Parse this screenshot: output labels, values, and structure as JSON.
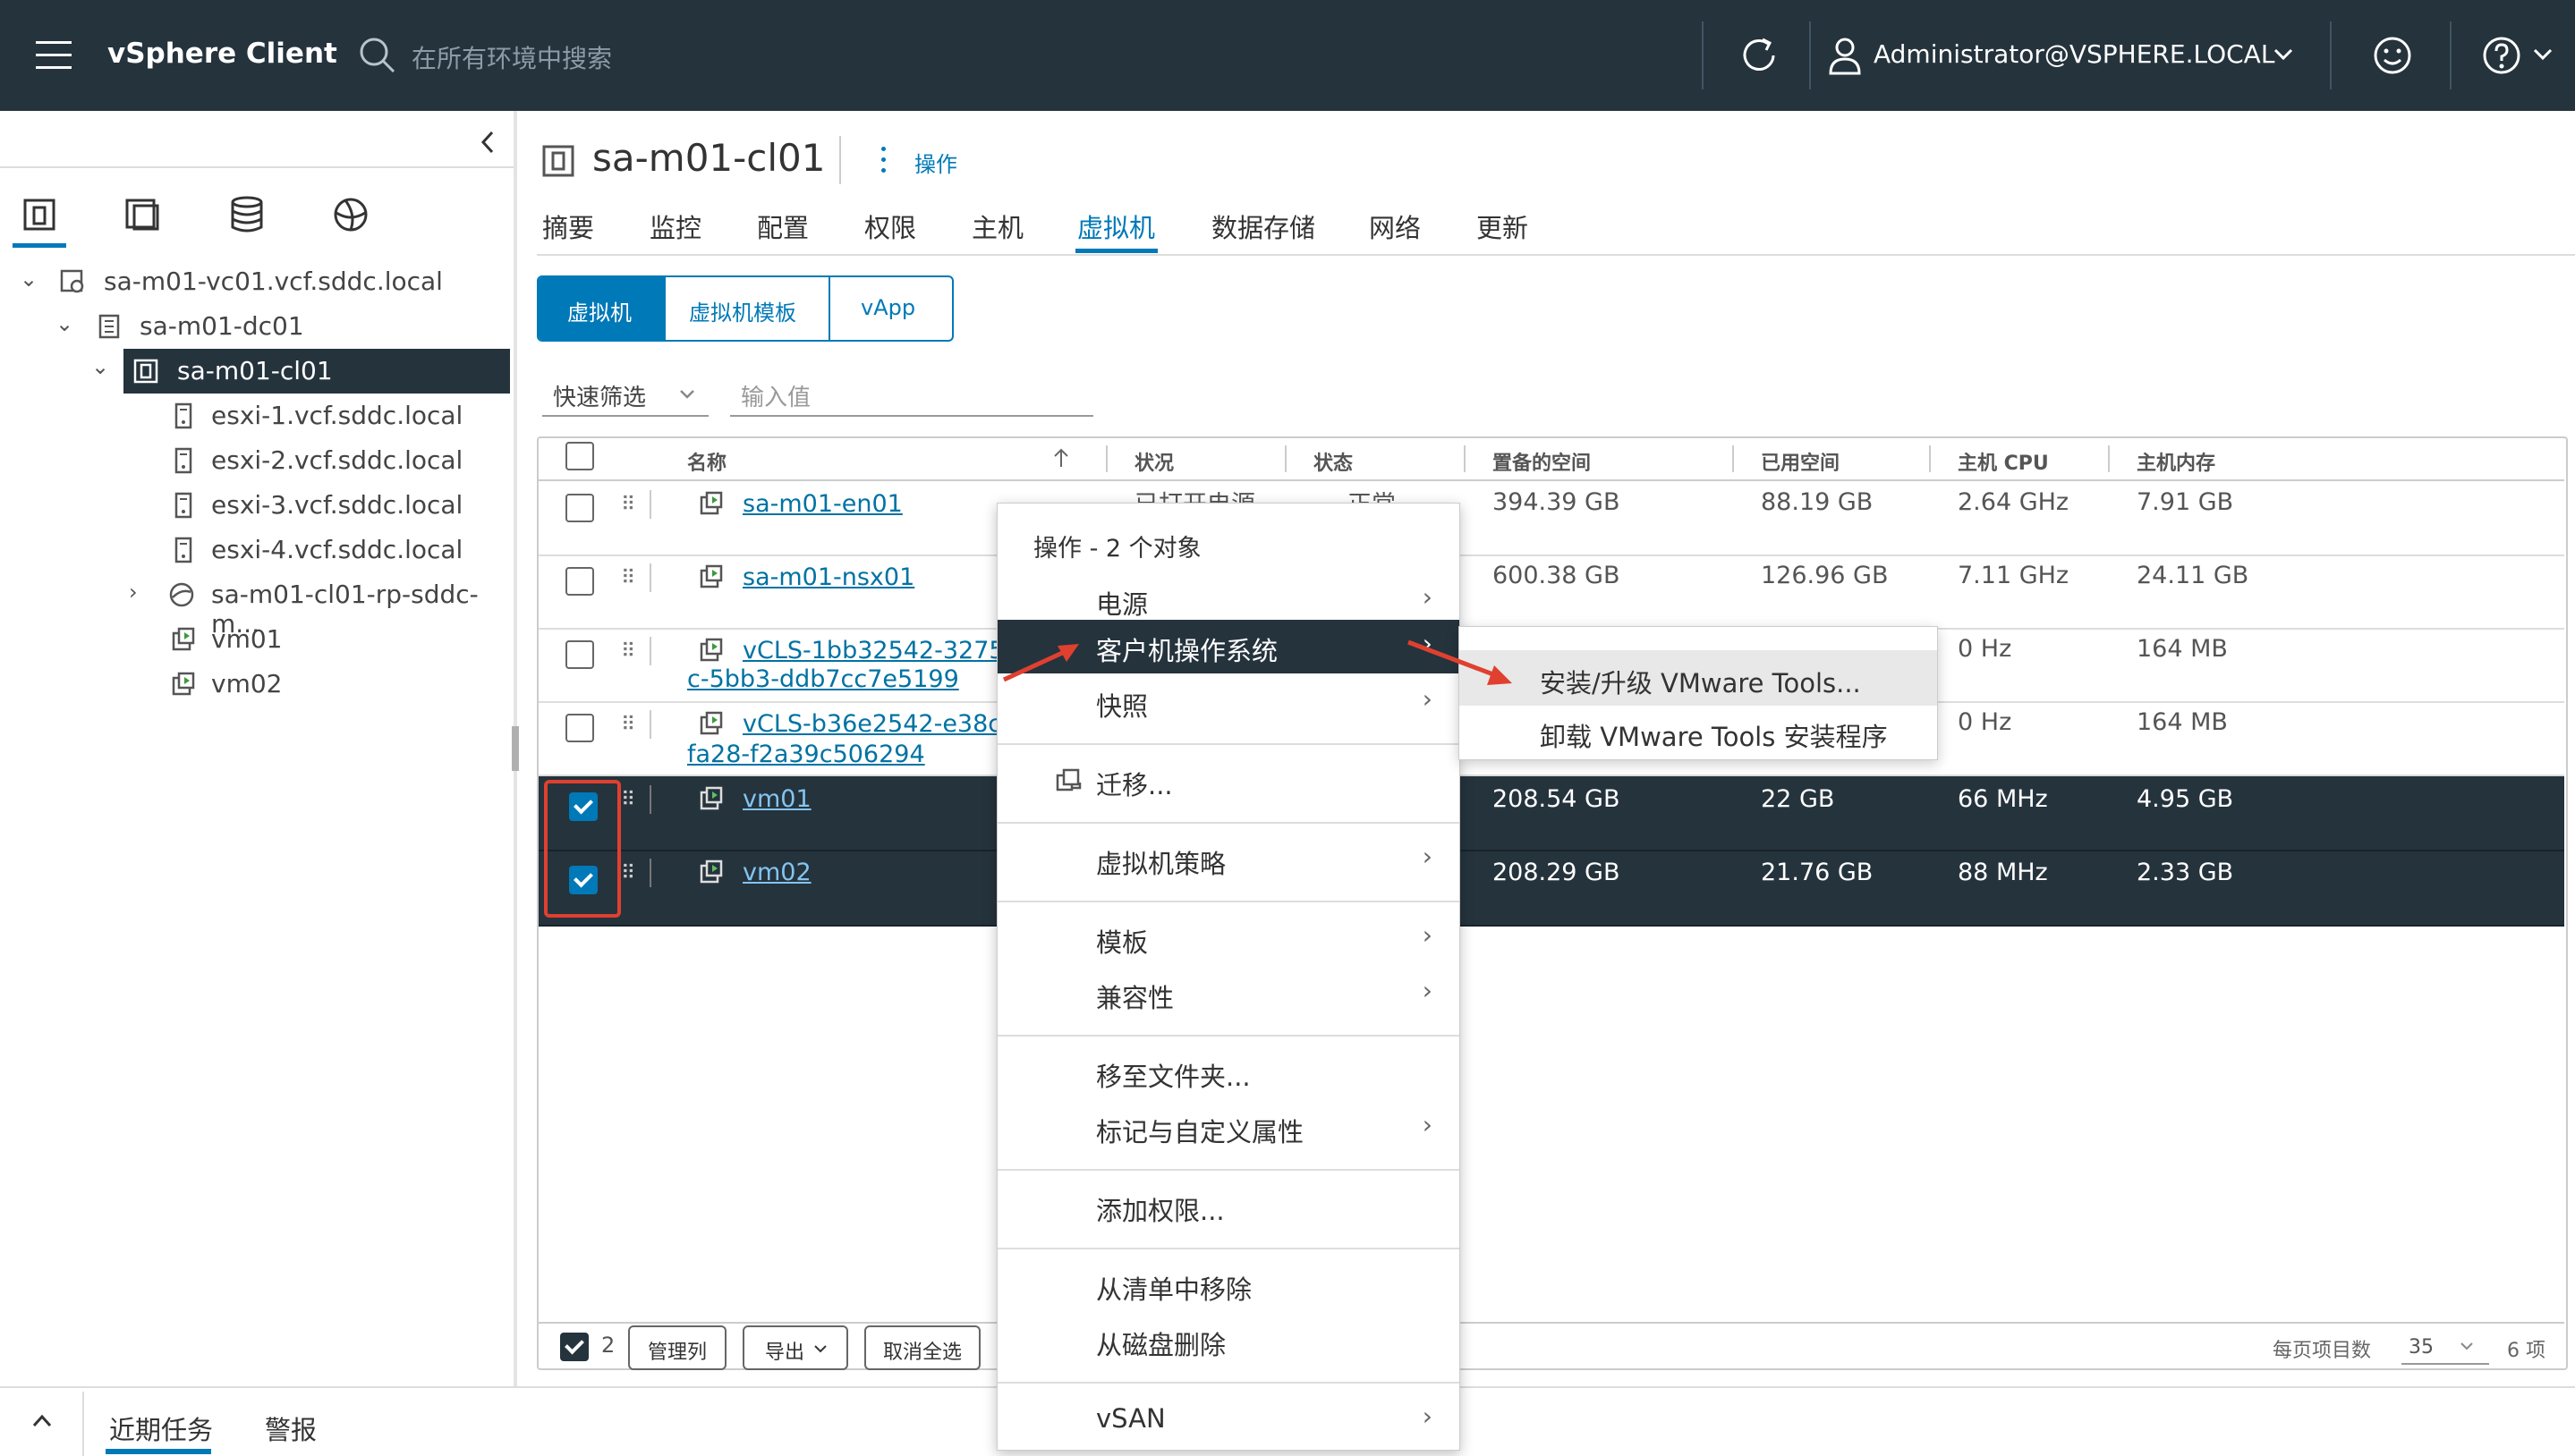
{
  "header": {
    "app_title": "vSphere Client",
    "search_placeholder": "在所有环境中搜索",
    "user": "Administrator@VSPHERE.LOCAL"
  },
  "sidebar": {
    "tree": [
      {
        "label": "sa-m01-vc01.vcf.sddc.local"
      },
      {
        "label": "sa-m01-dc01"
      },
      {
        "label": "sa-m01-cl01"
      },
      {
        "label": "esxi-1.vcf.sddc.local"
      },
      {
        "label": "esxi-2.vcf.sddc.local"
      },
      {
        "label": "esxi-3.vcf.sddc.local"
      },
      {
        "label": "esxi-4.vcf.sddc.local"
      },
      {
        "label": "sa-m01-cl01-rp-sddc-m..."
      },
      {
        "label": "vm01"
      },
      {
        "label": "vm02"
      }
    ]
  },
  "object": {
    "title": "sa-m01-cl01",
    "actions_label": "操作"
  },
  "tabs": [
    "摘要",
    "监控",
    "配置",
    "权限",
    "主机",
    "虚拟机",
    "数据存储",
    "网络",
    "更新"
  ],
  "subtabs": [
    "虚拟机",
    "虚拟机模板",
    "vApp"
  ],
  "filter": {
    "quick_filter": "快速筛选",
    "input_placeholder": "输入值"
  },
  "grid": {
    "columns": [
      "名称",
      "状况",
      "状态",
      "置备的空间",
      "已用空间",
      "主机 CPU",
      "主机内存"
    ],
    "rows": [
      {
        "name": "sa-m01-en01",
        "name2": "",
        "status": "已打开电源",
        "state": "正常",
        "prov": "394.39 GB",
        "used": "88.19 GB",
        "cpu": "2.64 GHz",
        "mem": "7.91 GB"
      },
      {
        "name": "sa-m01-nsx01",
        "name2": "",
        "status": "",
        "state": "",
        "prov": "600.38 GB",
        "used": "126.96 GB",
        "cpu": "7.11 GHz",
        "mem": "24.11 GB"
      },
      {
        "name": "vCLS-1bb32542-3275-",
        "name2": "c-5bb3-ddb7cc7e5199",
        "status": "",
        "state": "",
        "prov": "",
        "used": "",
        "cpu": "0 Hz",
        "mem": "164 MB"
      },
      {
        "name": "vCLS-b36e2542-e38c",
        "name2": "fa28-f2a39c506294",
        "status": "",
        "state": "",
        "prov": "",
        "used": "",
        "cpu": "0 Hz",
        "mem": "164 MB"
      },
      {
        "name": "vm01",
        "name2": "",
        "status": "",
        "state": "",
        "prov": "208.54 GB",
        "used": "22 GB",
        "cpu": "66 MHz",
        "mem": "4.95 GB"
      },
      {
        "name": "vm02",
        "name2": "",
        "status": "",
        "state": "",
        "prov": "208.29 GB",
        "used": "21.76 GB",
        "cpu": "88 MHz",
        "mem": "2.33 GB"
      }
    ]
  },
  "footer": {
    "selected_count": "2",
    "manage_columns": "管理列",
    "export": "导出",
    "deselect_all": "取消全选",
    "per_page_label": "每页项目数",
    "per_page": "35",
    "total": "6 项"
  },
  "bottom_tabs": [
    "近期任务",
    "警报"
  ],
  "context_menu": {
    "title": "操作 - 2 个对象",
    "items": [
      "电源",
      "客户机操作系统",
      "快照",
      "迁移...",
      "虚拟机策略",
      "模板",
      "兼容性",
      "移至文件夹...",
      "标记与自定义属性",
      "添加权限...",
      "从清单中移除",
      "从磁盘删除",
      "vSAN"
    ]
  },
  "submenu": {
    "items": [
      "安装/升级 VMware Tools...",
      "卸载 VMware Tools 安装程序"
    ]
  },
  "colors": {
    "header_bg": "#25333d",
    "accent": "#0079b8",
    "highlight_border": "#e0402f"
  }
}
